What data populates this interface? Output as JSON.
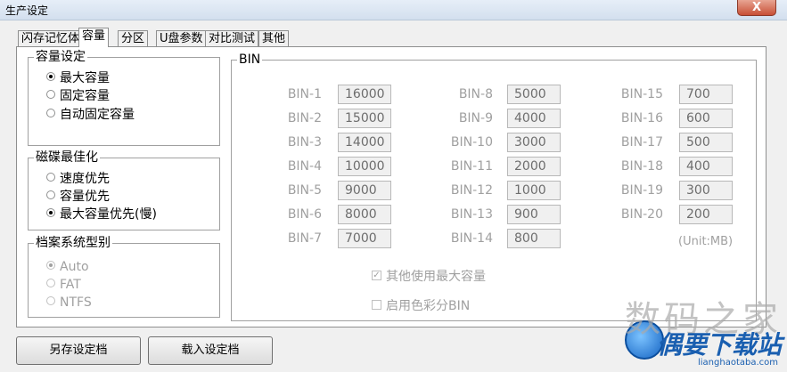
{
  "window": {
    "title": "生产设定",
    "close_label": "X"
  },
  "tabs": [
    {
      "label": "闪存记忆体"
    },
    {
      "label": "容量"
    },
    {
      "label": "分区"
    },
    {
      "label": "U盘参数"
    },
    {
      "label": "对比测试"
    },
    {
      "label": "其他"
    }
  ],
  "capacity_settings": {
    "legend": "容量设定",
    "options": [
      {
        "label": "最大容量",
        "selected": true
      },
      {
        "label": "固定容量",
        "selected": false
      },
      {
        "label": "自动固定容量",
        "selected": false
      }
    ]
  },
  "disk_optimize": {
    "legend": "磁碟最佳化",
    "options": [
      {
        "label": "速度优先",
        "selected": false
      },
      {
        "label": "容量优先",
        "selected": false
      },
      {
        "label": "最大容量优先(慢)",
        "selected": true
      }
    ]
  },
  "filesystem": {
    "legend": "档案系统型别",
    "options": [
      {
        "label": "Auto",
        "selected": true
      },
      {
        "label": "FAT",
        "selected": false
      },
      {
        "label": "NTFS",
        "selected": false
      }
    ]
  },
  "bin": {
    "legend": "BIN",
    "entries": [
      {
        "label": "BIN-1",
        "value": "16000"
      },
      {
        "label": "BIN-2",
        "value": "15000"
      },
      {
        "label": "BIN-3",
        "value": "14000"
      },
      {
        "label": "BIN-4",
        "value": "10000"
      },
      {
        "label": "BIN-5",
        "value": "9000"
      },
      {
        "label": "BIN-6",
        "value": "8000"
      },
      {
        "label": "BIN-7",
        "value": "7000"
      },
      {
        "label": "BIN-8",
        "value": "5000"
      },
      {
        "label": "BIN-9",
        "value": "4000"
      },
      {
        "label": "BIN-10",
        "value": "3000"
      },
      {
        "label": "BIN-11",
        "value": "2000"
      },
      {
        "label": "BIN-12",
        "value": "1000"
      },
      {
        "label": "BIN-13",
        "value": "900"
      },
      {
        "label": "BIN-14",
        "value": "800"
      },
      {
        "label": "BIN-15",
        "value": "700"
      },
      {
        "label": "BIN-16",
        "value": "600"
      },
      {
        "label": "BIN-17",
        "value": "500"
      },
      {
        "label": "BIN-18",
        "value": "400"
      },
      {
        "label": "BIN-19",
        "value": "300"
      },
      {
        "label": "BIN-20",
        "value": "200"
      }
    ],
    "unit": "(Unit:MB)",
    "use_max_label": "其他使用最大容量",
    "use_max_checked": true,
    "color_bin_label": "启用色彩分BIN",
    "color_bin_checked": false
  },
  "buttons": {
    "save": "另存设定档",
    "load": "载入设定档"
  },
  "watermark": {
    "line1": "数码之家",
    "line2": "偶要下载站",
    "line3": "lianghaotaba.com"
  }
}
